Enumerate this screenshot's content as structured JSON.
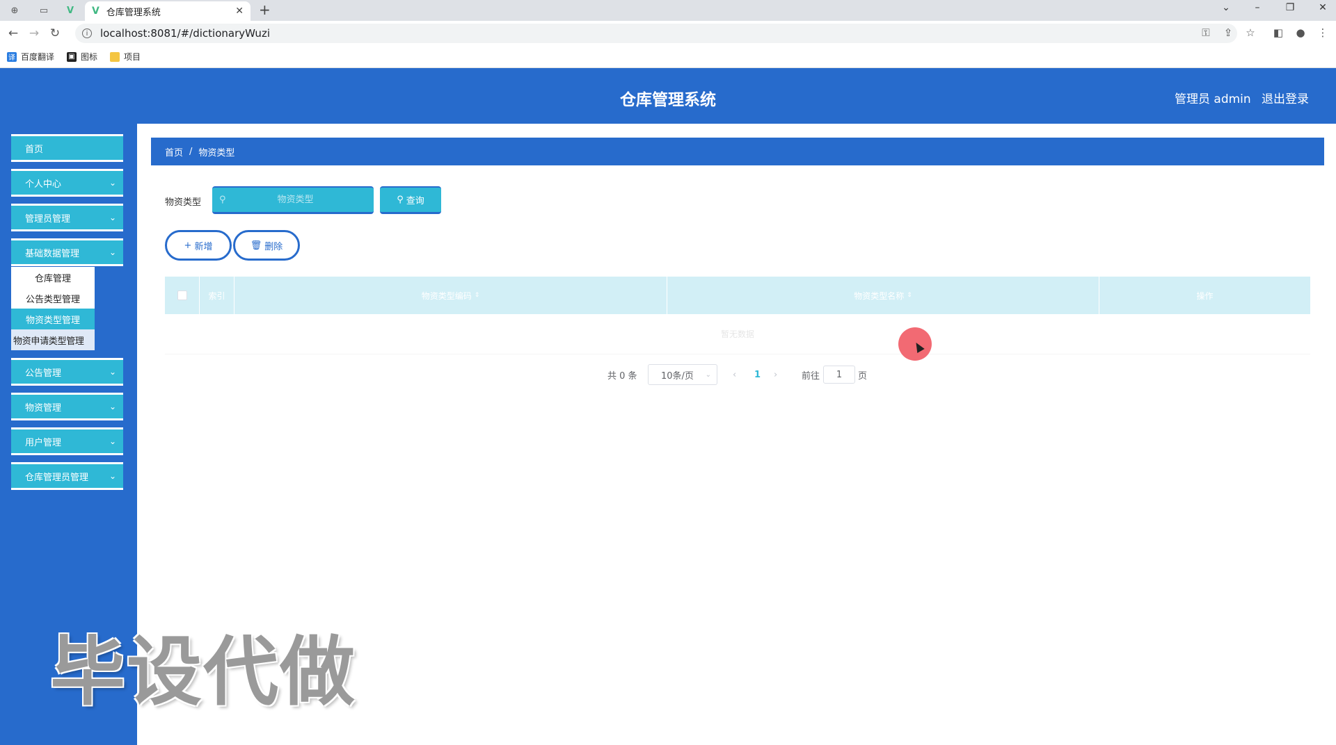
{
  "browser": {
    "tab_title": "仓库管理系统",
    "url": "localhost:8081/#/dictionaryWuzi",
    "bookmarks": [
      {
        "label": "百度翻译",
        "icon": "translate-icon"
      },
      {
        "label": "图标",
        "icon": "image-icon"
      },
      {
        "label": "项目",
        "icon": "folder-icon"
      }
    ]
  },
  "header": {
    "title": "仓库管理系统",
    "user_label": "管理员 admin",
    "logout": "退出登录"
  },
  "sidebar": {
    "items": [
      {
        "label": "首页",
        "has_children": false
      },
      {
        "label": "个人中心",
        "has_children": true
      },
      {
        "label": "管理员管理",
        "has_children": true
      },
      {
        "label": "基础数据管理",
        "has_children": true
      },
      {
        "label": "公告管理",
        "has_children": true
      },
      {
        "label": "物资管理",
        "has_children": true
      },
      {
        "label": "用户管理",
        "has_children": true
      },
      {
        "label": "仓库管理员管理",
        "has_children": true
      }
    ],
    "submenu": [
      "仓库管理",
      "公告类型管理",
      "物资类型管理",
      "物资申请类型管理"
    ],
    "active_submenu": "物资类型管理"
  },
  "breadcrumb": {
    "home": "首页",
    "current": "物资类型"
  },
  "search": {
    "label": "物资类型",
    "placeholder": "物资类型",
    "value": "",
    "button": "查询"
  },
  "actions": {
    "add": "新增",
    "delete": "删除"
  },
  "table": {
    "columns": [
      "索引",
      "物资类型编码",
      "物资类型名称",
      "操作"
    ],
    "rows": [],
    "empty_text": "暂无数据"
  },
  "pagination": {
    "total": "共 0 条",
    "page_size": "10条/页",
    "current_page": "1",
    "goto_label": "前往",
    "goto_value": "1",
    "page_suffix": "页"
  },
  "watermark": "毕设代做",
  "colors": {
    "primary": "#276bcc",
    "accent": "#2fb8d6",
    "header_row": "#d2eff6",
    "cursor": "#f0505a"
  }
}
